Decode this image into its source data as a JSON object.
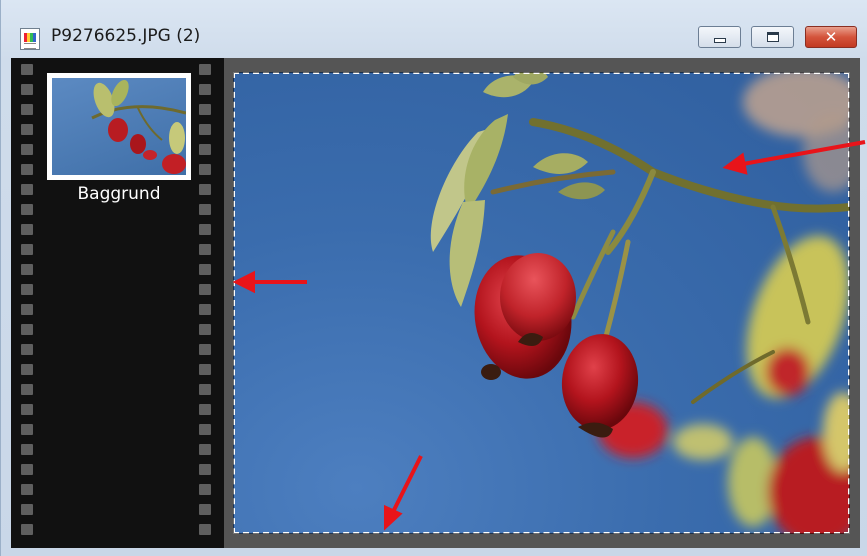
{
  "window": {
    "title": "P9276625.JPG (2)",
    "icon": "image-file-icon",
    "controls": {
      "minimize": "minimize-icon",
      "maximize": "maximize-icon",
      "close": "close-icon",
      "close_glyph": "✕"
    }
  },
  "filmstrip": {
    "layers": [
      {
        "label": "Baggrund",
        "selected": true
      }
    ]
  },
  "colors": {
    "titlebar": "#cfdceb",
    "filmstrip": "#111111",
    "workspace": "#555555",
    "close_button": "#c9402a",
    "annotation_arrow": "#e8141a",
    "sky": "#3a6cad"
  }
}
